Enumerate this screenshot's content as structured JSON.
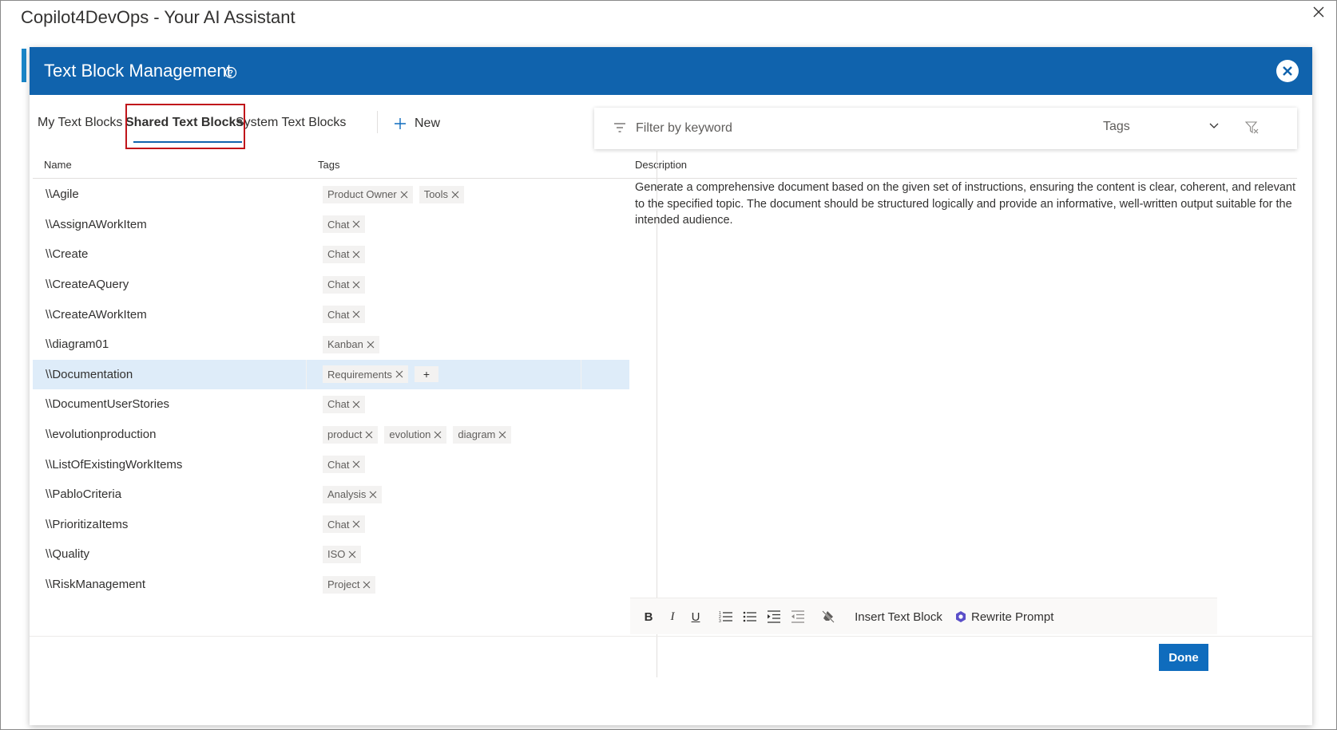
{
  "window": {
    "title": "Copilot4DevOps - Your AI Assistant"
  },
  "dialog": {
    "title": "Text Block Management"
  },
  "tabs": [
    {
      "label": "My Text Blocks"
    },
    {
      "label": "Shared Text Blocks"
    },
    {
      "label": "System Text Blocks"
    }
  ],
  "new_label": "New",
  "filter": {
    "placeholder": "Filter by keyword",
    "tags_label": "Tags"
  },
  "columns": {
    "name": "Name",
    "tags": "Tags",
    "description": "Description"
  },
  "rows": [
    {
      "name": "\\\\Agile",
      "tags": [
        "Product Owner",
        "Tools"
      ]
    },
    {
      "name": "\\\\AssignAWorkItem",
      "tags": [
        "Chat"
      ]
    },
    {
      "name": "\\\\Create",
      "tags": [
        "Chat"
      ]
    },
    {
      "name": "\\\\CreateAQuery",
      "tags": [
        "Chat"
      ]
    },
    {
      "name": "\\\\CreateAWorkItem",
      "tags": [
        "Chat"
      ]
    },
    {
      "name": "\\\\diagram01",
      "tags": [
        "Kanban"
      ]
    },
    {
      "name": "\\\\Documentation",
      "tags": [
        "Requirements"
      ],
      "selected": true
    },
    {
      "name": "\\\\DocumentUserStories",
      "tags": [
        "Chat"
      ]
    },
    {
      "name": "\\\\evolutionproduction",
      "tags": [
        "product",
        "evolution",
        "diagram"
      ]
    },
    {
      "name": "\\\\ListOfExistingWorkItems",
      "tags": [
        "Chat"
      ]
    },
    {
      "name": "\\\\PabloCriteria",
      "tags": [
        "Analysis"
      ]
    },
    {
      "name": "\\\\PrioritizaItems",
      "tags": [
        "Chat"
      ]
    },
    {
      "name": "\\\\Quality",
      "tags": [
        "ISO"
      ]
    },
    {
      "name": "\\\\RiskManagement",
      "tags": [
        "Project"
      ]
    }
  ],
  "add_tag_label": "+",
  "description": "Generate a comprehensive document based on the given set of instructions, ensuring the content is clear, coherent, and relevant to the specified topic. The document should be structured logically and provide an informative, well-written output suitable for the intended audience.",
  "toolbar": {
    "bold": "B",
    "italic": "I",
    "underline": "U",
    "insert_text_block": "Insert Text Block",
    "rewrite_prompt": "Rewrite Prompt"
  },
  "done_label": "Done",
  "colors": {
    "header": "#1063ad",
    "selected_row": "#deecf9",
    "highlight_border": "#c0141a",
    "rewrite_icon": "#5b4fc9"
  }
}
